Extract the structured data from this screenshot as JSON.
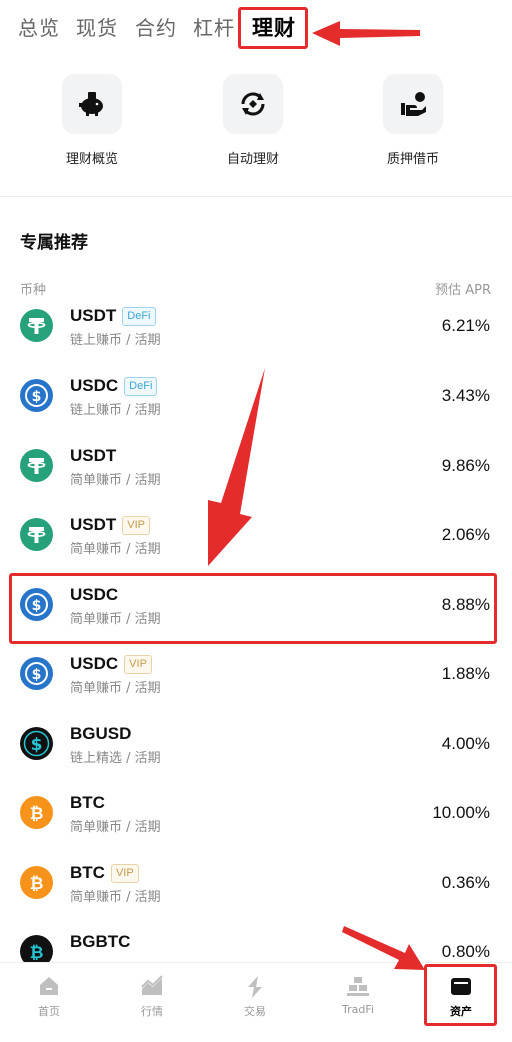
{
  "tabs": [
    {
      "label": "总览",
      "active": false
    },
    {
      "label": "现货",
      "active": false
    },
    {
      "label": "合约",
      "active": false
    },
    {
      "label": "杠杆",
      "active": false
    },
    {
      "label": "理财",
      "active": true
    }
  ],
  "quick_actions": [
    {
      "label": "理财概览",
      "icon": "piggy-bank-icon"
    },
    {
      "label": "自动理财",
      "icon": "auto-cycle-icon"
    },
    {
      "label": "质押借币",
      "icon": "pledge-loan-icon"
    }
  ],
  "section_title": "专属推荐",
  "columns": {
    "coin": "币种",
    "apr": "预估 APR"
  },
  "products": [
    {
      "name": "USDT",
      "badge": "DeFi",
      "sub": "链上赚币 / 活期",
      "apr": "6.21%",
      "icon": "usdt-icon"
    },
    {
      "name": "USDC",
      "badge": "DeFi",
      "sub": "链上赚币 / 活期",
      "apr": "3.43%",
      "icon": "usdc-icon"
    },
    {
      "name": "USDT",
      "badge": "",
      "sub": "简单赚币 / 活期",
      "apr": "9.86%",
      "icon": "usdt-icon"
    },
    {
      "name": "USDT",
      "badge": "VIP",
      "sub": "简单赚币 / 活期",
      "apr": "2.06%",
      "icon": "usdt-icon"
    },
    {
      "name": "USDC",
      "badge": "",
      "sub": "简单赚币 / 活期",
      "apr": "8.88%",
      "icon": "usdc-icon"
    },
    {
      "name": "USDC",
      "badge": "VIP",
      "sub": "简单赚币 / 活期",
      "apr": "1.88%",
      "icon": "usdc-icon"
    },
    {
      "name": "BGUSD",
      "badge": "",
      "sub": "链上精选 / 活期",
      "apr": "4.00%",
      "icon": "bgusd-icon"
    },
    {
      "name": "BTC",
      "badge": "",
      "sub": "简单赚币 / 活期",
      "apr": "10.00%",
      "icon": "btc-icon"
    },
    {
      "name": "BTC",
      "badge": "VIP",
      "sub": "简单赚币 / 活期",
      "apr": "0.36%",
      "icon": "btc-icon"
    },
    {
      "name": "BGBTC",
      "badge": "",
      "sub": "",
      "apr": "0.80%",
      "icon": "bgbtc-icon"
    }
  ],
  "bottom_nav": [
    {
      "label": "首页",
      "icon": "home-icon",
      "active": false
    },
    {
      "label": "行情",
      "icon": "market-chart-icon",
      "active": false
    },
    {
      "label": "交易",
      "icon": "trade-icon",
      "active": false
    },
    {
      "label": "TradFi",
      "icon": "tradfi-icon",
      "active": false
    },
    {
      "label": "资产",
      "icon": "wallet-icon",
      "active": true
    }
  ],
  "colors": {
    "highlight": "#e52c2c",
    "usdt": "#26a17b",
    "usdc": "#2775ca",
    "btc": "#f7931a",
    "bgusd": "#111111"
  }
}
